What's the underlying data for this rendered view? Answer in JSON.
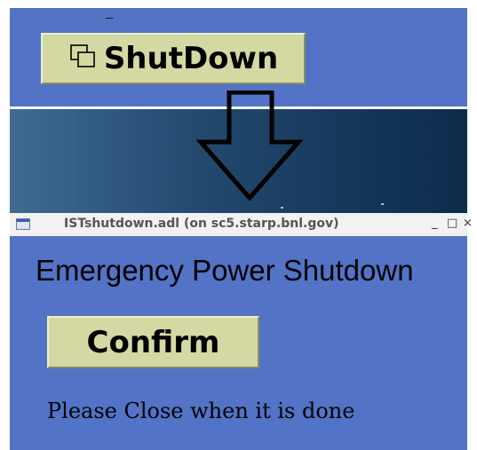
{
  "top_panel": {
    "shutdown_button": {
      "label": "ShutDown",
      "icon": "windows-stack-icon"
    }
  },
  "arrow": {
    "icon": "down-arrow-icon"
  },
  "window": {
    "title": "ISTshutdown.adl (on sc5.starp.bnl.gov)",
    "minimize_label": "_",
    "maximize_label": "□",
    "close_label": "×",
    "heading": "Emergency Power Shutdown",
    "confirm_label": "Confirm",
    "note": "Please Close when it is done"
  },
  "colors": {
    "panel_blue": "#5273c6",
    "button_khaki": "#d4d9a3",
    "desktop_dark": "#14375a"
  }
}
